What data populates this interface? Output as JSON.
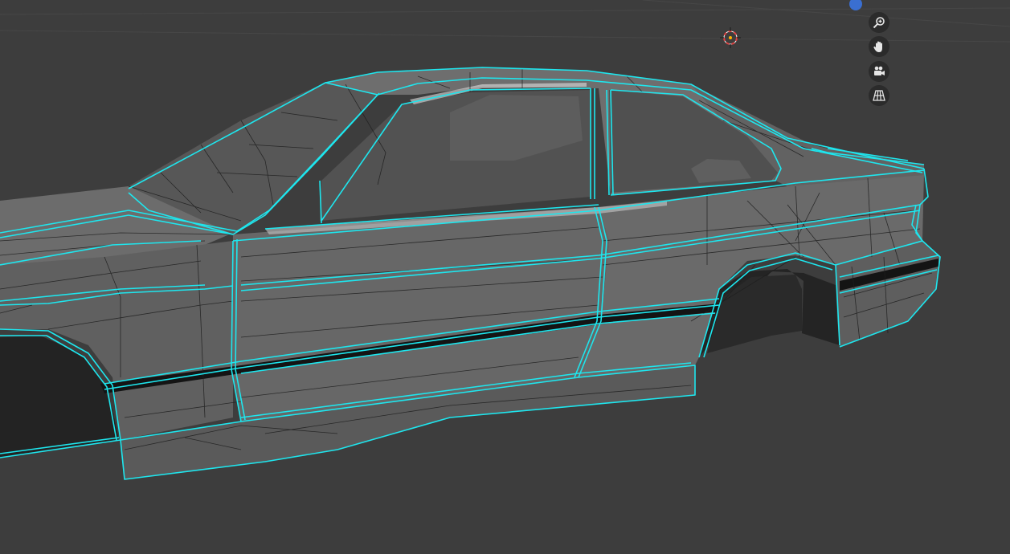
{
  "viewport": {
    "background": "#3d3d3d",
    "grid_color": "#474747",
    "mesh_body_color": "#6a6a6a",
    "mesh_shadow_color": "#4d4d4d",
    "wire_color": "#1f1f1f",
    "seam_color": "#1ee6ee",
    "wheel_well_color": "#232323",
    "glass_color": "#565656"
  },
  "navigation_gizmo": {
    "axis_dot_color": "#3a6fd1",
    "buttons": [
      {
        "name": "zoom",
        "icon": "zoom-in-icon"
      },
      {
        "name": "pan",
        "icon": "hand-icon"
      },
      {
        "name": "camera",
        "icon": "camera-icon"
      },
      {
        "name": "perspective",
        "icon": "grid-perspective-icon"
      }
    ]
  },
  "cursor_3d": {
    "icon": "3d-cursor-icon",
    "ring_color": "#e04040",
    "center_color": "#ffb000"
  }
}
